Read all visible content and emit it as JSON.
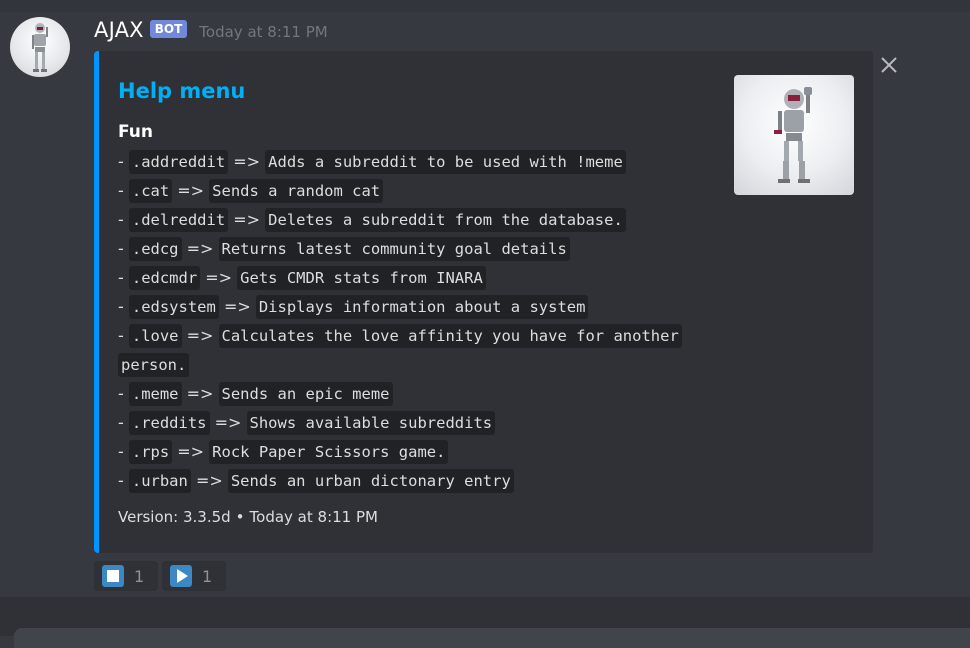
{
  "message": {
    "author": "AJAX",
    "badge": "BOT",
    "timestamp": "Today at 8:11 PM"
  },
  "embed": {
    "title": "Help menu",
    "accent_color": "#0096ff",
    "field_name": "Fun",
    "lines": [
      {
        "prefix": "- ",
        "cmd": ".addreddit",
        "arrow": " => ",
        "desc": "Adds a subreddit to be used with !meme"
      },
      {
        "prefix": "- ",
        "cmd": ".cat",
        "arrow": " => ",
        "desc": "Sends a random cat"
      },
      {
        "prefix": "- ",
        "cmd": ".delreddit",
        "arrow": " => ",
        "desc": "Deletes a subreddit from the database."
      },
      {
        "prefix": "- ",
        "cmd": ".edcg",
        "arrow": " => ",
        "desc": "Returns latest community goal details"
      },
      {
        "prefix": "- ",
        "cmd": ".edcmdr",
        "arrow": " => ",
        "desc": "Gets CMDR stats from INARA"
      },
      {
        "prefix": "- ",
        "cmd": ".edsystem",
        "arrow": " => ",
        "desc": "Displays information about a system"
      },
      {
        "prefix": "- ",
        "cmd": ".love",
        "arrow": " => ",
        "desc": "Calculates the love affinity you have for another "
      },
      {
        "prefix": "",
        "cmd": "",
        "arrow": "",
        "desc": "person."
      },
      {
        "prefix": "- ",
        "cmd": ".meme",
        "arrow": " => ",
        "desc": "Sends an epic meme"
      },
      {
        "prefix": "- ",
        "cmd": ".reddits",
        "arrow": " => ",
        "desc": "Shows available subreddits"
      },
      {
        "prefix": "- ",
        "cmd": ".rps",
        "arrow": " => ",
        "desc": "Rock Paper Scissors game."
      },
      {
        "prefix": "- ",
        "cmd": ".urban",
        "arrow": " => ",
        "desc": "Sends an urban dictonary entry"
      }
    ],
    "footer_version": "Version: 3.3.5d",
    "footer_separator": "•",
    "footer_time": "Today at 8:11 PM"
  },
  "reactions": [
    {
      "icon": "stop-button-icon",
      "count": "1"
    },
    {
      "icon": "play-button-icon",
      "count": "1"
    }
  ],
  "colors": {
    "background": "#36393f",
    "embed_bg": "#2f3136",
    "title": "#00aff4",
    "bot_badge": "#7289da"
  }
}
